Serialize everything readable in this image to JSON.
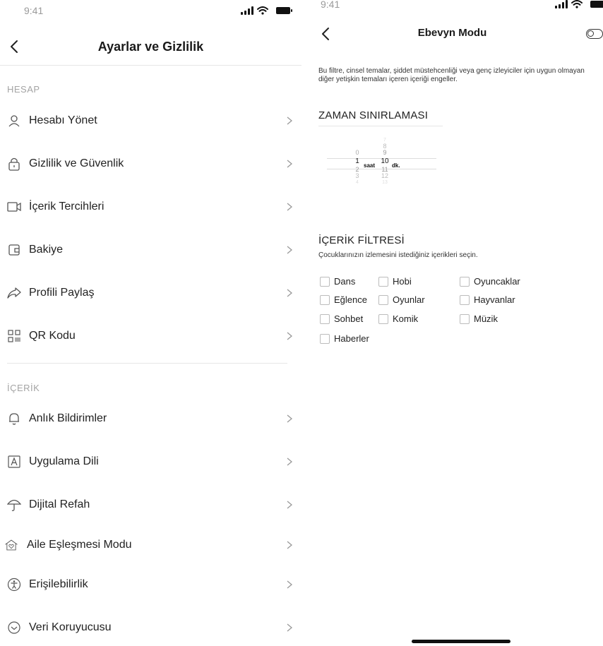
{
  "left": {
    "status_time": "9:41",
    "title": "Ayarlar ve Gizlilik",
    "sections": [
      {
        "header": "HESAP",
        "items": [
          {
            "label": "Hesabı Yönet",
            "icon": "person-icon"
          },
          {
            "label": "Gizlilik ve Güvenlik",
            "icon": "lock-icon"
          },
          {
            "label": "İçerik Tercihleri",
            "icon": "video-icon"
          },
          {
            "label": "Bakiye",
            "icon": "wallet-icon"
          },
          {
            "label": "Profili Paylaş",
            "icon": "share-icon"
          },
          {
            "label": "QR Kodu",
            "icon": "qr-code-icon"
          }
        ]
      },
      {
        "header": "İÇERİK",
        "items": [
          {
            "label": "Anlık Bildirimler",
            "icon": "bell-icon"
          },
          {
            "label": "Uygulama Dili",
            "icon": "language-icon"
          },
          {
            "label": "Dijital Refah",
            "icon": "umbrella-icon"
          },
          {
            "label": "Aile Eşleşmesi Modu",
            "icon": "home-heart-icon"
          },
          {
            "label": "Erişilebilirlik",
            "icon": "accessibility-icon"
          },
          {
            "label": "Veri Koruyucusu",
            "icon": "data-saver-icon"
          }
        ]
      }
    ]
  },
  "right": {
    "status_time": "9:41",
    "title": "Ebevyn Modu",
    "toggle_on": false,
    "description": "Bu filtre, cinsel temalar, şiddet müstehcenliği veya genç izleyiciler için uygun olmayan diğer yetişkin temaları içeren içeriği engeller.",
    "time_limit_title": "ZAMAN SINIRLAMASI",
    "picker": {
      "hours_before": [
        "0"
      ],
      "hour_selected": "1",
      "hour_unit": "saat",
      "hours_after": [
        "2",
        "3",
        "4"
      ],
      "minutes_before": [
        "7",
        "8",
        "9"
      ],
      "minute_selected": "10",
      "minute_unit": "dk.",
      "minutes_after": [
        "11",
        "12",
        "13"
      ]
    },
    "content_filter_title": "İÇERİK FİLTRESİ",
    "content_filter_subtitle": "Çocuklarınızın izlemesini istediğiniz içerikleri seçin.",
    "filters": [
      [
        "Dans",
        "Hobi",
        "Oyuncaklar"
      ],
      [
        "Eğlence",
        "Oyunlar",
        "Hayvanlar"
      ],
      [
        "Sohbet",
        "Komik",
        "Müzik"
      ],
      [
        "Haberler"
      ]
    ]
  }
}
